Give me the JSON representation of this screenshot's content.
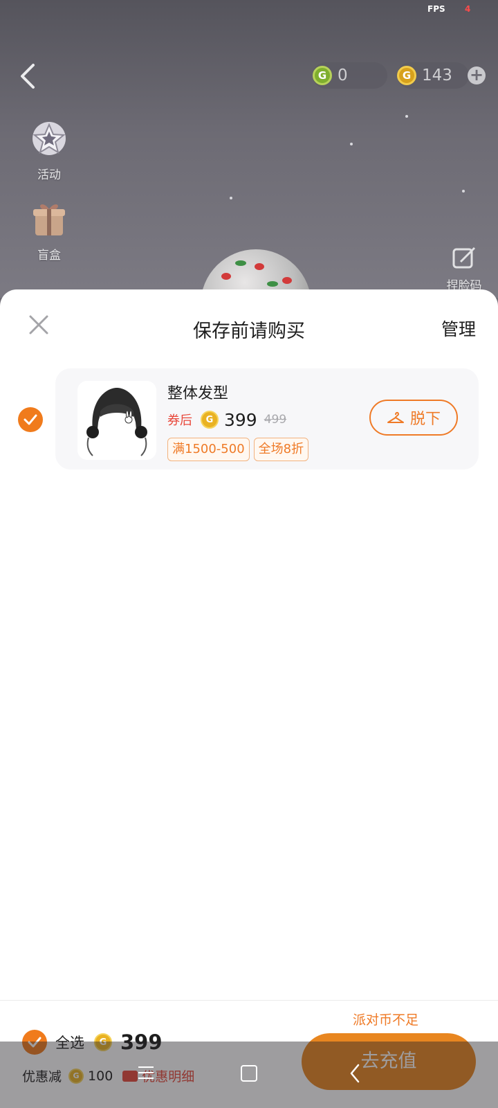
{
  "status": {
    "fps_label": "FPS",
    "fps_value": "4"
  },
  "top_bar": {
    "green_coin_value": "0",
    "gold_coin_value": "143",
    "coin_glyph": "G"
  },
  "side_menu": [
    {
      "label": "活动",
      "icon": "star-badge-icon"
    },
    {
      "label": "盲盒",
      "icon": "gift-box-icon"
    }
  ],
  "face_code": {
    "label": "捏脸码",
    "icon": "edit-icon"
  },
  "sheet": {
    "title": "保存前请购买",
    "manage_label": "管理",
    "item": {
      "name": "整体发型",
      "after_coupon_label": "券后",
      "price": "399",
      "original_price": "499",
      "tags": [
        "满1500-500",
        "全场8折"
      ],
      "take_off_label": "脱下",
      "selected": true
    }
  },
  "footer": {
    "insufficient_label": "派对币不足",
    "select_all_label": "全选",
    "total": "399",
    "discount_label": "优惠减",
    "discount_value": "100",
    "detail_label": "优惠明细",
    "recharge_label": "去充值"
  },
  "colors": {
    "accent": "#ef7a26",
    "sale_red": "#e8473a",
    "gold": "#e9b223"
  }
}
